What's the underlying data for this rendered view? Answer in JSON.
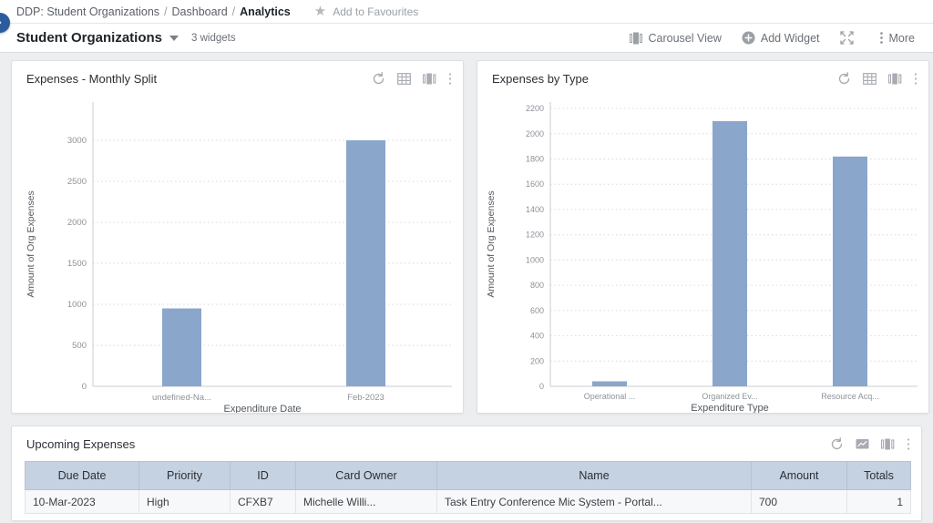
{
  "breadcrumb": {
    "items": [
      "DDP: Student Organizations",
      "Dashboard",
      "Analytics"
    ],
    "separator": "/",
    "favourite_label": "Add to Favourites",
    "star_glyph": "★"
  },
  "sidebar_toggle": {
    "glyph": "›",
    "color": "#2a5c9e"
  },
  "title_bar": {
    "dashboard_name": "Student Organizations",
    "widget_count": "3 widgets",
    "tools": [
      {
        "label": "Carousel View",
        "icon": "carousel-icon"
      },
      {
        "label": "Add Widget",
        "icon": "plus-circle-icon"
      },
      {
        "label": "",
        "icon": "expand-icon"
      },
      {
        "label": "More",
        "icon": "kebab-icon"
      }
    ]
  },
  "widgets": [
    {
      "title": "Expenses - Monthly Split",
      "icons": [
        "refresh-icon",
        "table-icon",
        "bar-chart-icon",
        "kebab-icon"
      ]
    },
    {
      "title": "Expenses by Type",
      "icons": [
        "refresh-icon",
        "table-icon",
        "bar-chart-icon",
        "kebab-icon"
      ]
    },
    {
      "title": "Upcoming Expenses",
      "icons": [
        "refresh-icon",
        "image-chart-icon",
        "bar-chart-icon",
        "kebab-icon"
      ]
    }
  ],
  "chart_data": [
    {
      "type": "bar",
      "title": "Expenses - Monthly Split",
      "categories": [
        "undefined-Na...",
        "Feb-2023"
      ],
      "values": [
        950,
        3000
      ],
      "xlabel": "Expenditure Date",
      "ylabel": "Amount of Org Expenses",
      "ylim": [
        0,
        3200
      ],
      "yticks": [
        0,
        500,
        1000,
        1500,
        2000,
        2500,
        3000
      ],
      "grid": true,
      "bar_color": "#8aa6cb",
      "legend": "none"
    },
    {
      "type": "bar",
      "title": "Expenses by Type",
      "categories": [
        "Operational ...",
        "Organized Ev...",
        "Resource Acq..."
      ],
      "values": [
        40,
        2100,
        1820
      ],
      "xlabel": "Expenditure Type",
      "ylabel": "Amount of Org Expenses",
      "ylim": [
        0,
        2300
      ],
      "yticks": [
        0,
        200,
        400,
        600,
        800,
        1000,
        1200,
        1400,
        1600,
        1800,
        2000,
        2200
      ],
      "grid": true,
      "bar_color": "#8aa6cb",
      "legend": "none"
    }
  ],
  "table": {
    "columns": [
      "Due Date",
      "Priority",
      "ID",
      "Card Owner",
      "Name",
      "Amount",
      "Totals"
    ],
    "rows": [
      {
        "due_date": "10-Mar-2023",
        "priority": "High",
        "id": "CFXB7",
        "card_owner": "Michelle Willi...",
        "name": "Task Entry Conference Mic System - Portal...",
        "amount": "700",
        "totals": "1"
      }
    ]
  },
  "colors": {
    "accent": "#2a5c9e",
    "bar": "#8aa6cb",
    "table_header": "#c5d2e2",
    "page_bg": "#eceef0"
  }
}
